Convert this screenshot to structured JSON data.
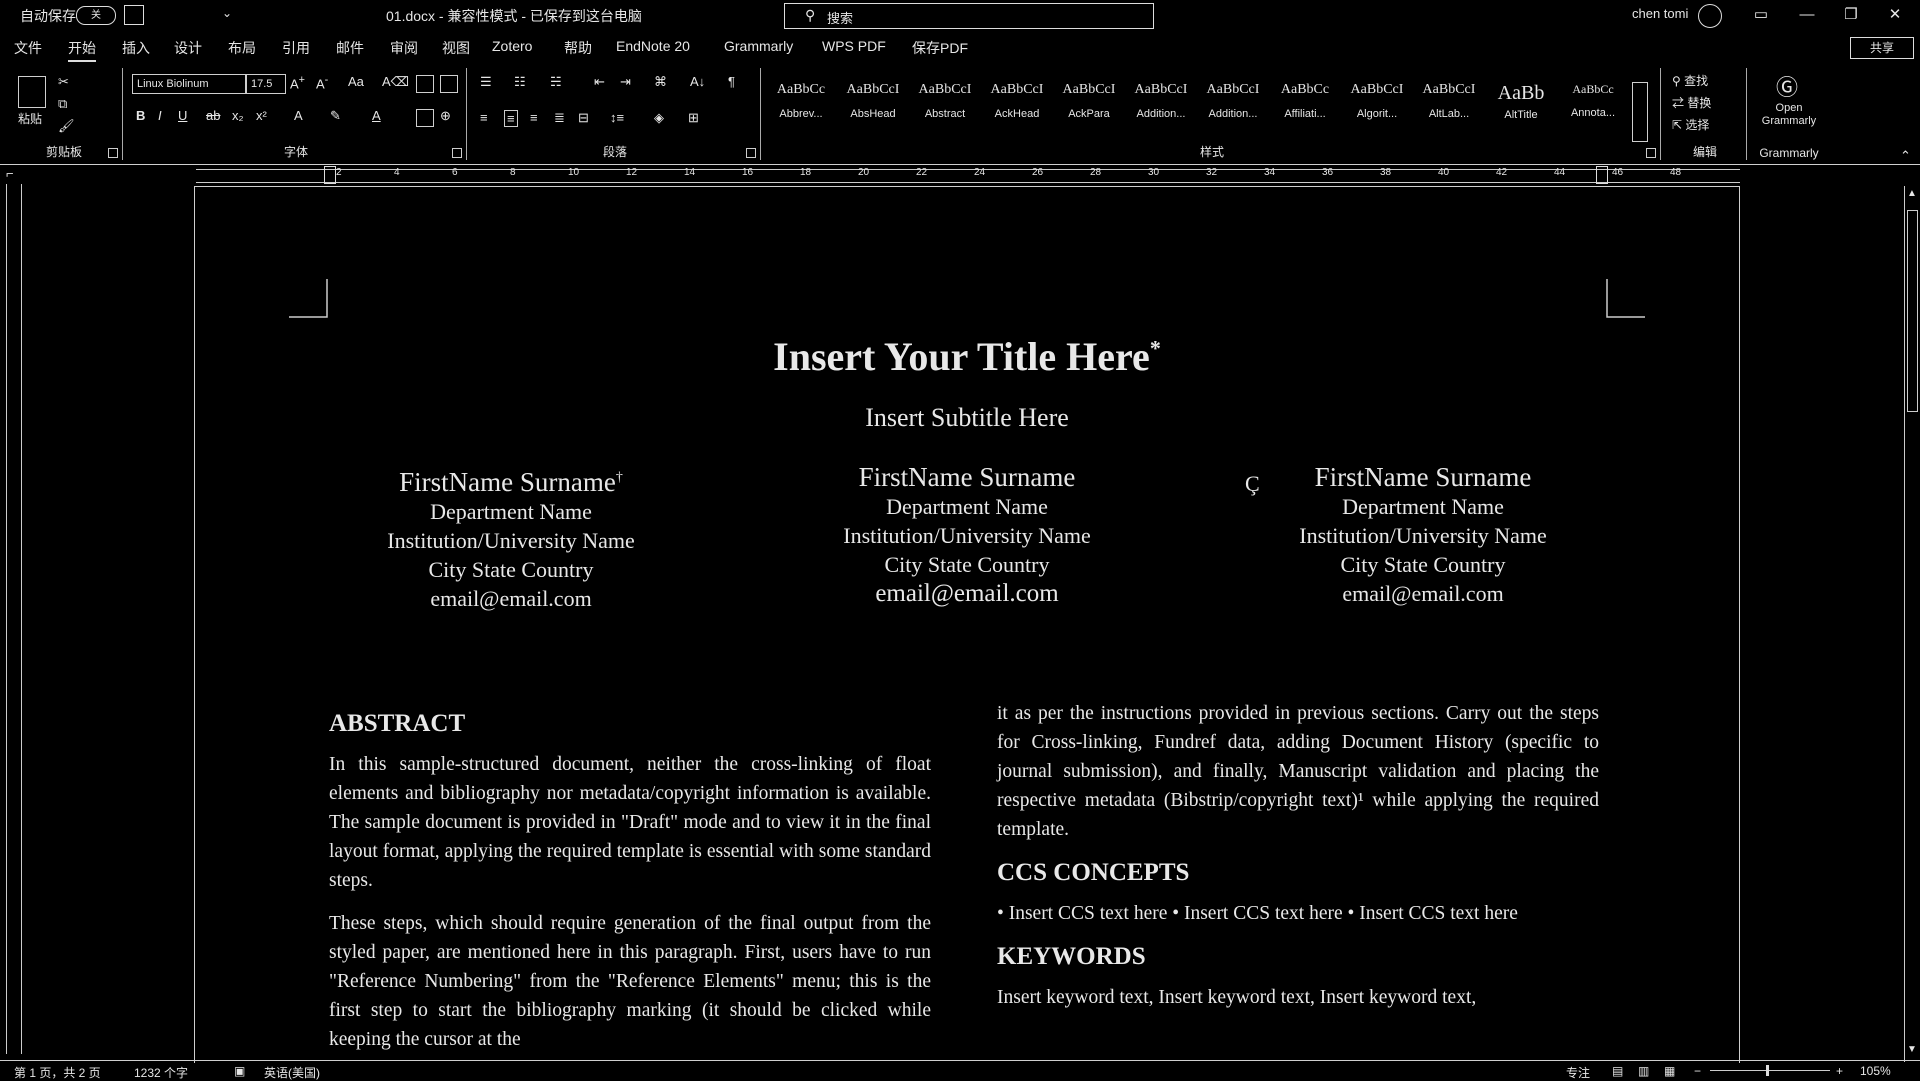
{
  "titlebar": {
    "autosave_label": "自动保存",
    "autosave_state": "关",
    "document_title": "01.docx - 兼容性模式 - 已保存到这台电脑",
    "search_placeholder": "搜索",
    "user_name": "chen tomi"
  },
  "menu": {
    "tabs": [
      "文件",
      "开始",
      "插入",
      "设计",
      "布局",
      "引用",
      "邮件",
      "审阅",
      "视图",
      "Zotero",
      "帮助",
      "EndNote 20",
      "Grammarly",
      "WPS PDF",
      "保存PDF"
    ],
    "active_tab": "开始",
    "share_label": "共享"
  },
  "ribbon": {
    "clipboard": {
      "label": "剪贴板",
      "paste_label": "粘贴"
    },
    "font": {
      "label": "字体",
      "font_name": "Linux Biolinum",
      "font_size": "17.5"
    },
    "paragraph": {
      "label": "段落"
    },
    "styles": {
      "label": "样式",
      "items": [
        {
          "sample": "AaBbCc",
          "name": "Abbrev..."
        },
        {
          "sample": "AaBbCcI",
          "name": "AbsHead"
        },
        {
          "sample": "AaBbCcI",
          "name": "Abstract"
        },
        {
          "sample": "AaBbCcI",
          "name": "AckHead"
        },
        {
          "sample": "AaBbCcI",
          "name": "AckPara"
        },
        {
          "sample": "AaBbCcI",
          "name": "Addition..."
        },
        {
          "sample": "AaBbCcI",
          "name": "Addition..."
        },
        {
          "sample": "AaBbCc",
          "name": "Affiliati..."
        },
        {
          "sample": "AaBbCcI",
          "name": "Algorit..."
        },
        {
          "sample": "AaBbCcI",
          "name": "AltLab..."
        },
        {
          "sample": "AaBb",
          "name": "AltTitle"
        },
        {
          "sample": "AaBbCc",
          "name": "Annota..."
        }
      ]
    },
    "editing": {
      "label": "编辑",
      "find": "查找",
      "replace": "替换",
      "select": "选择"
    },
    "grammarly": {
      "label": "Grammarly",
      "open_label": "Open Grammarly"
    }
  },
  "ruler": {
    "numbers": [
      "2",
      "4",
      "6",
      "8",
      "10",
      "12",
      "14",
      "16",
      "18",
      "20",
      "22",
      "24",
      "26",
      "28",
      "30",
      "32",
      "34",
      "36",
      "38",
      "40",
      "42",
      "44",
      "46",
      "48"
    ]
  },
  "document": {
    "title": "Insert Your Title Here",
    "title_mark": "*",
    "subtitle": "Insert Subtitle Here",
    "authors": [
      {
        "name": "FirstName Surname",
        "mark": "†",
        "department": "Department Name",
        "institution": "Institution/University Name",
        "location": "City State Country",
        "email": "email@email.com"
      },
      {
        "name": "FirstName Surname",
        "mark": "",
        "department": "Department Name",
        "institution": "Institution/University Name",
        "location": "City State Country",
        "email": "email@email.com"
      },
      {
        "name": "FirstName Surname",
        "mark": "",
        "department": "Department Name",
        "institution": "Institution/University Name",
        "location": "City State Country",
        "email": "email@email.com"
      }
    ],
    "abstract_heading": "ABSTRACT",
    "abstract_p1": "In this sample-structured document, neither the cross-linking of float elements and bibliography nor metadata/copyright information is available. The sample document is provided in \"Draft\" mode and to view it in the final layout format, applying the required template is essential with some standard steps.",
    "abstract_p2": "These steps, which should require generation of the final output from the styled paper, are mentioned here in this paragraph. First, users have to run \"Reference Numbering\" from the \"Reference Elements\" menu; this is the first step to start the bibliography marking (it should be clicked while keeping the cursor at the",
    "right_p1": "it as per the instructions provided in previous sections. Carry out the steps for Cross-linking, Fundref data, adding Document History (specific to journal submission), and finally, Manuscript validation and placing the respective metadata (Bibstrip/copyright text)¹ while applying the required template.",
    "ccs_heading": "CCS CONCEPTS",
    "ccs_text": "• Insert CCS text here • Insert CCS text here • Insert CCS text here",
    "keywords_heading": "KEYWORDS",
    "keywords_text": "Insert keyword text, Insert keyword text, Insert keyword text,",
    "paragraph_mark": "Ç"
  },
  "statusbar": {
    "page": "第 1 页，共 2 页",
    "words": "1232 个字",
    "language": "英语(美国)",
    "focus": "专注",
    "zoom": "105%"
  }
}
